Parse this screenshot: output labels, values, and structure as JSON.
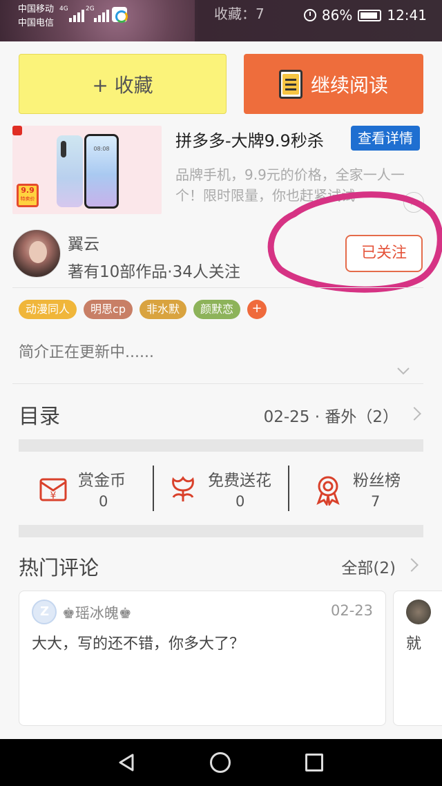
{
  "status_bar": {
    "carrier_1": "中国移动",
    "carrier_2": "中国电信",
    "network_1": "4G",
    "network_2": "2G",
    "favorites_text": "收藏：7",
    "battery": "86%",
    "time": "12:41"
  },
  "buttons": {
    "favorite_label": "+ 收藏",
    "continue_reading_label": "继续阅读"
  },
  "ad": {
    "title": "拼多多-大牌9.9秒杀",
    "details_button": "查看详情",
    "description": "品牌手机，9.9元的价格，全家一人一个！限时限量，你也赶紧试试",
    "badge_price": "9.9",
    "badge_text": "特卖价",
    "phone_time": "08:08",
    "close_icon": "close-icon"
  },
  "author": {
    "name": "翼云",
    "meta": "著有10部作品·34人关注",
    "follow_label": "已关注"
  },
  "tags": [
    {
      "label": "动漫同人",
      "color": "#f0b63a"
    },
    {
      "label": "明思cp",
      "color": "#c87f66"
    },
    {
      "label": "非水默",
      "color": "#d9a33f"
    },
    {
      "label": "颜默恋",
      "color": "#8db35a"
    }
  ],
  "tag_add_label": "+",
  "intro": "简介正在更新中......",
  "catalog": {
    "title": "目录",
    "latest": "02-25 · 番外（2）"
  },
  "actions": [
    {
      "label": "赏金币",
      "count": "0",
      "icon": "red-envelope-icon"
    },
    {
      "label": "免费送花",
      "count": "0",
      "icon": "flower-icon"
    },
    {
      "label": "粉丝榜",
      "count": "7",
      "icon": "medal-icon"
    }
  ],
  "comments": {
    "title": "热门评论",
    "all_label": "全部(2)",
    "items": [
      {
        "user": "♚瑶冰魄♚",
        "date": "02-23",
        "text": "大大，写的还不错，你多大了？"
      },
      {
        "text": "就"
      }
    ]
  },
  "colors": {
    "favorite_bg": "#fbf37a",
    "read_bg": "#ee6d3c",
    "accent_red": "#e4533a",
    "highlight_circle": "#d63384"
  }
}
